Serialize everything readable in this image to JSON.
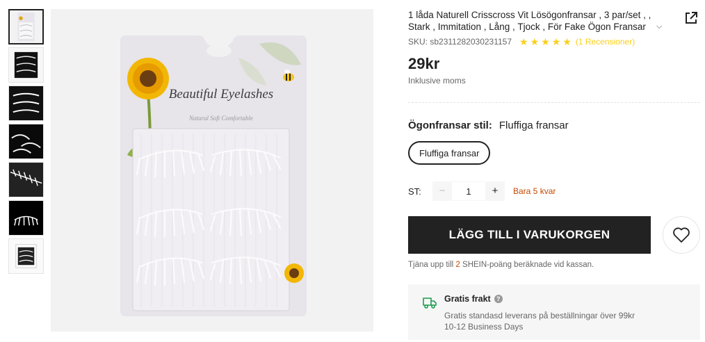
{
  "product": {
    "title": "1 låda Naturell Crisscross Vit Lösögonfransar , 3 par/set , , Stark , Immitation , Lång , Tjock , För Fake Ögon Fransar",
    "sku_text": "SKU: sb2311282030231157",
    "rating_stars": 5,
    "reviews_text": "(1 Recensioner)",
    "price": "29kr",
    "vat_note": "Inklusive moms",
    "package_brand_text": "Beautiful Eyelashes",
    "package_sub_text": "Natural Soft Comfortable"
  },
  "attribute": {
    "label": "Ögonfransar stil:",
    "value": "Fluffiga fransar",
    "options": [
      "Fluffiga fransar"
    ]
  },
  "quantity": {
    "label": "ST:",
    "value": "1",
    "minus": "−",
    "plus": "+",
    "stock_note": "Bara 5 kvar"
  },
  "cart": {
    "add_label": "LÄGG TILL I VARUKORGEN"
  },
  "points": {
    "prefix": "Tjäna upp till",
    "amount": "2",
    "suffix": "SHEIN-poäng beräknade vid kassan."
  },
  "shipping": {
    "title": "Gratis frakt",
    "help": "?",
    "line1": "Gratis standasd leverans på beställningar över 99kr",
    "line2": "10-12 Business Days"
  },
  "icons": {
    "share": "share-external-icon",
    "chevron": "chevron-down-icon",
    "star": "star-icon",
    "heart": "heart-icon",
    "truck": "truck-icon"
  },
  "colors": {
    "accent_star": "#facf19",
    "stock_warning": "#c44a01",
    "button_dark": "#222222"
  }
}
